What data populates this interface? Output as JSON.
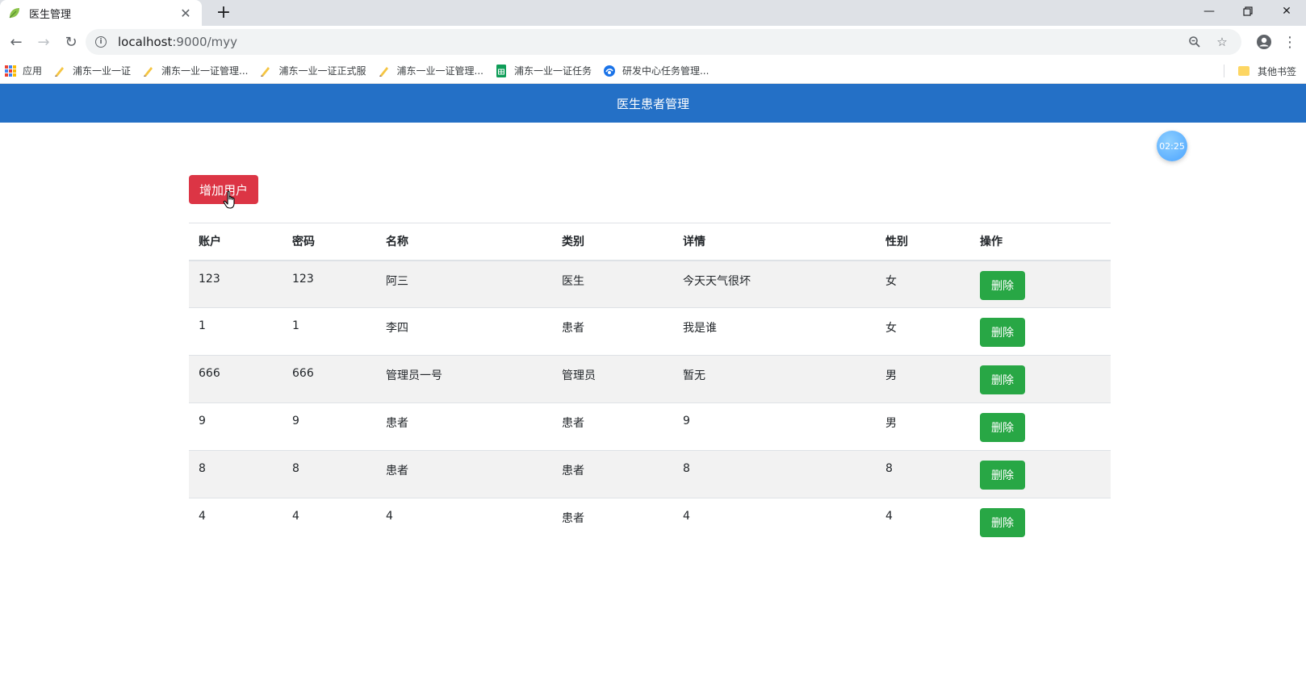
{
  "browser": {
    "tab_title": "医生管理",
    "url_host": "localhost",
    "url_path": ":9000/myy",
    "bookmarks": [
      {
        "label": "应用",
        "icon": "apps-grid-icon"
      },
      {
        "label": "浦东一业一证",
        "icon": "pen-icon"
      },
      {
        "label": "浦东一业一证管理...",
        "icon": "pen-icon"
      },
      {
        "label": "浦东一业一证正式服",
        "icon": "pen-icon"
      },
      {
        "label": "浦东一业一证管理...",
        "icon": "pen-icon"
      },
      {
        "label": "浦东一业一证任务",
        "icon": "sheets-icon"
      },
      {
        "label": "研发中心任务管理...",
        "icon": "globe-icon"
      }
    ],
    "other_bookmarks": "其他书签"
  },
  "header": {
    "title": "医生患者管理"
  },
  "timer": "02:25",
  "add_button": "增加用户",
  "table": {
    "headers": [
      "账户",
      "密码",
      "名称",
      "类别",
      "详情",
      "性别",
      "操作"
    ],
    "rows": [
      {
        "account": "123",
        "password": "123",
        "name": "阿三",
        "type": "医生",
        "detail": "今天天气很坏",
        "gender": "女",
        "action": "删除"
      },
      {
        "account": "1",
        "password": "1",
        "name": "李四",
        "type": "患者",
        "detail": "我是谁",
        "gender": "女",
        "action": "删除"
      },
      {
        "account": "666",
        "password": "666",
        "name": "管理员一号",
        "type": "管理员",
        "detail": "暂无",
        "gender": "男",
        "action": "删除"
      },
      {
        "account": "9",
        "password": "9",
        "name": "患者",
        "type": "患者",
        "detail": "9",
        "gender": "男",
        "action": "删除"
      },
      {
        "account": "8",
        "password": "8",
        "name": "患者",
        "type": "患者",
        "detail": "8",
        "gender": "8",
        "action": "删除"
      },
      {
        "account": "4",
        "password": "4",
        "name": "4",
        "type": "患者",
        "detail": "4",
        "gender": "4",
        "action": "删除"
      }
    ]
  },
  "colors": {
    "header_bg": "#2470c6",
    "add_button_bg": "#dc3545",
    "delete_button_bg": "#28a745"
  }
}
